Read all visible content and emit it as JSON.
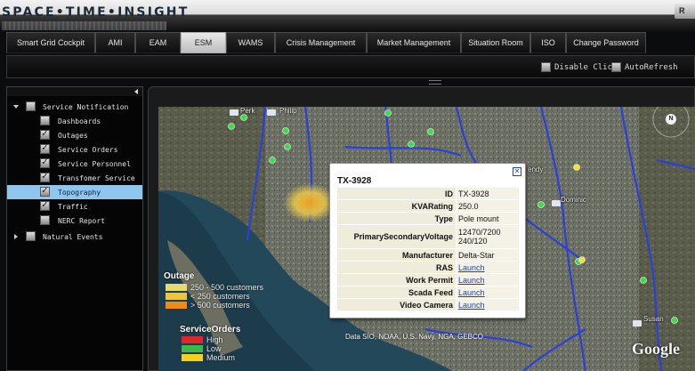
{
  "brand": {
    "logo_text": "SPACE•TIME•INSIGHT"
  },
  "nav": {
    "tabs": [
      {
        "label": "Smart Grid Cockpit"
      },
      {
        "label": "AMI"
      },
      {
        "label": "EAM"
      },
      {
        "label": "ESM",
        "active": true
      },
      {
        "label": "WAMS"
      },
      {
        "label": "Crisis Management"
      },
      {
        "label": "Market Management"
      },
      {
        "label": "Situation Room"
      },
      {
        "label": "ISO"
      },
      {
        "label": "Change Password"
      }
    ]
  },
  "toolbar": {
    "disable_click_label": "Disable Click",
    "auto_refresh_label": "AutoRefresh",
    "refresh_button_label": "R"
  },
  "sidebar": {
    "items": [
      {
        "label": "Service Notification",
        "expanded": true,
        "checked": false,
        "level": 0
      },
      {
        "label": "Dashboards",
        "checked": false,
        "level": 1
      },
      {
        "label": "Outages",
        "checked": true,
        "level": 1
      },
      {
        "label": "Service Orders",
        "checked": true,
        "level": 1
      },
      {
        "label": "Service Personnel",
        "checked": true,
        "level": 1
      },
      {
        "label": "Transfomer Service",
        "checked": true,
        "level": 1
      },
      {
        "label": "Topography",
        "checked": true,
        "level": 1,
        "selected": true
      },
      {
        "label": "Traffic",
        "checked": true,
        "level": 1
      },
      {
        "label": "NERC Report",
        "checked": false,
        "level": 1
      },
      {
        "label": "Natural Events",
        "expanded": false,
        "checked": false,
        "level": 0
      }
    ]
  },
  "map": {
    "place_labels": [
      "Perk",
      "Philip",
      "endy",
      "Dominic",
      "Susan"
    ],
    "north_label": "N",
    "attribution": "Data SIO, NOAA, U.S. Navy, NGA, GEBCO",
    "watermark": "Google"
  },
  "legend": {
    "outage_title": "Outage",
    "outage_items": [
      {
        "label": "250 - 500 customers",
        "color": "#e9d96a"
      },
      {
        "label": "< 250 customers",
        "color": "#f2c23b"
      },
      {
        "label": "> 500 customers",
        "color": "#f08a1c"
      }
    ],
    "orders_title": "ServiceOrders",
    "orders_items": [
      {
        "label": "High",
        "color": "#e0262a"
      },
      {
        "label": "Low",
        "color": "#3cb84a"
      },
      {
        "label": "Medium",
        "color": "#f2d21c"
      }
    ]
  },
  "popup": {
    "title": "TX-3928",
    "rows": [
      {
        "key": "ID",
        "value": "TX-3928",
        "link": false
      },
      {
        "key": "KVARating",
        "value": "250.0",
        "link": false
      },
      {
        "key": "Type",
        "value": "Pole mount",
        "link": false
      },
      {
        "key": "PrimarySecondaryVoltage",
        "value": "12470/7200\n240/120",
        "link": false
      },
      {
        "key": "Manufacturer",
        "value": "Delta-Star",
        "link": false
      },
      {
        "key": "RAS",
        "value": "Launch",
        "link": true
      },
      {
        "key": "Work Permit",
        "value": "Launch",
        "link": true
      },
      {
        "key": "Scada Feed",
        "value": "Launch",
        "link": true
      },
      {
        "key": "Video Camera",
        "value": "Launch",
        "link": true
      }
    ]
  },
  "colors": {
    "accent_selected": "#8ec6ef",
    "road_blue": "#2c3fd8",
    "status_green": "#3fdc4a",
    "status_yellow": "#f2e22a"
  }
}
